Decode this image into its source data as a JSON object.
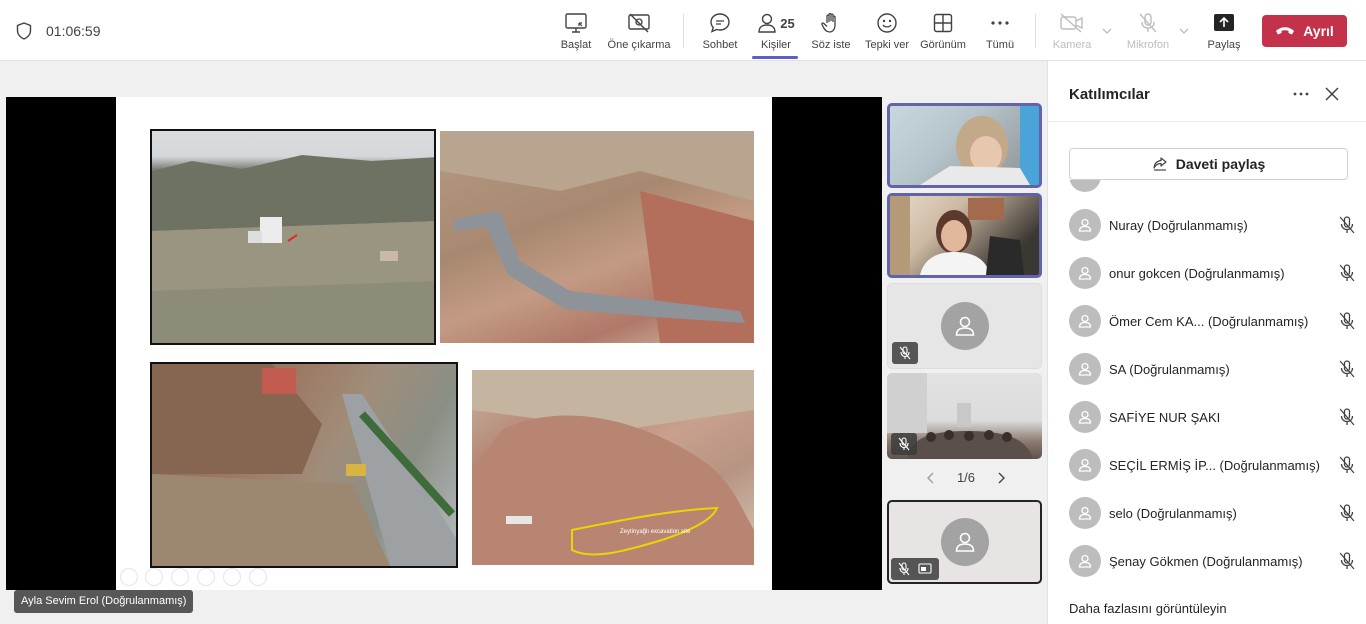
{
  "topbar": {
    "timer": "01:06:59",
    "buttons": {
      "start": "Başlat",
      "spotlight": "Öne çıkarma",
      "chat": "Sohbet",
      "people": "Kişiler",
      "people_count": "25",
      "raise_hand": "Söz iste",
      "react": "Tepki ver",
      "view": "Görünüm",
      "more": "Tümü",
      "camera": "Kamera",
      "mic": "Mikrofon",
      "share": "Paylaş"
    },
    "leave_label": "Ayrıl"
  },
  "stage": {
    "presenter_name": "Ayla Sevim Erol (Doğrulanmamış)",
    "slide_annotation": "Zeytinyağlı excavation site"
  },
  "gallery": {
    "pager": "1/6"
  },
  "panel": {
    "title": "Katılımcılar",
    "share_invite": "Daveti paylaş",
    "participants": [
      {
        "name": "Nuray (Doğrulanmamış)"
      },
      {
        "name": "onur gokcen (Doğrulanmamış)"
      },
      {
        "name": "Ömer Cem KA...   (Doğrulanmamış)"
      },
      {
        "name": "SA (Doğrulanmamış)"
      },
      {
        "name": "SAFİYE NUR ŞAKI"
      },
      {
        "name": "SEÇİL ERMİŞ İP...   (Doğrulanmamış)"
      },
      {
        "name": "selo (Doğrulanmamış)"
      },
      {
        "name": "Şenay Gökmen (Doğrulanmamış)"
      }
    ],
    "show_more": "Daha fazlasını görüntüleyin"
  },
  "colors": {
    "accent": "#5b5fc7",
    "leave": "#c4314b"
  }
}
